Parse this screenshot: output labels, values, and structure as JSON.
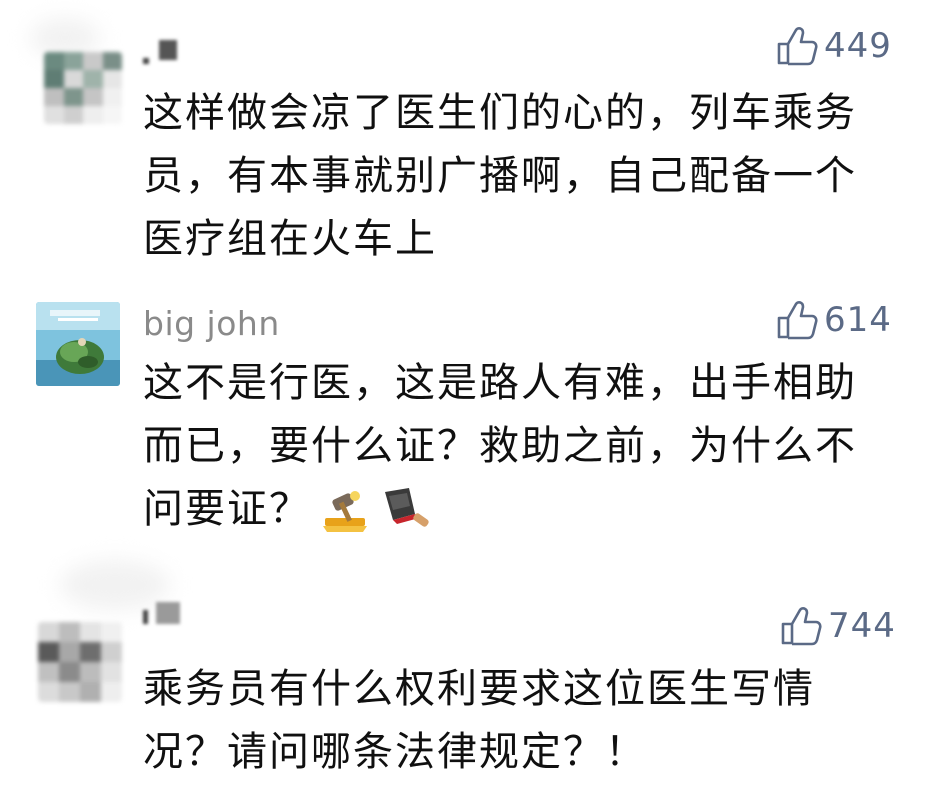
{
  "comments": [
    {
      "author": "",
      "likes": "449",
      "lines": [
        "这样做会凉了医生们的心的，列车乘务",
        "员，有本事就别广播啊，自己配备一个",
        "医疗组在火车上"
      ]
    },
    {
      "author": "big john",
      "likes": "614",
      "lines": [
        "这不是行医，这是路人有难，出手相助",
        "而已，要什么证？救助之前，为什么不",
        "问要证？"
      ],
      "emojis": [
        "gavel-emoji",
        "cleaver-emoji"
      ]
    },
    {
      "author": "",
      "likes": "744",
      "lines": [
        "乘务员有什么权利要求这位医生写情",
        "况？请问哪条法律规定？！"
      ]
    }
  ],
  "icons": {
    "like": "thumbs-up-icon"
  },
  "colors": {
    "likes": "#5b6a86",
    "name": "#8a8a8a",
    "text": "#101010"
  }
}
